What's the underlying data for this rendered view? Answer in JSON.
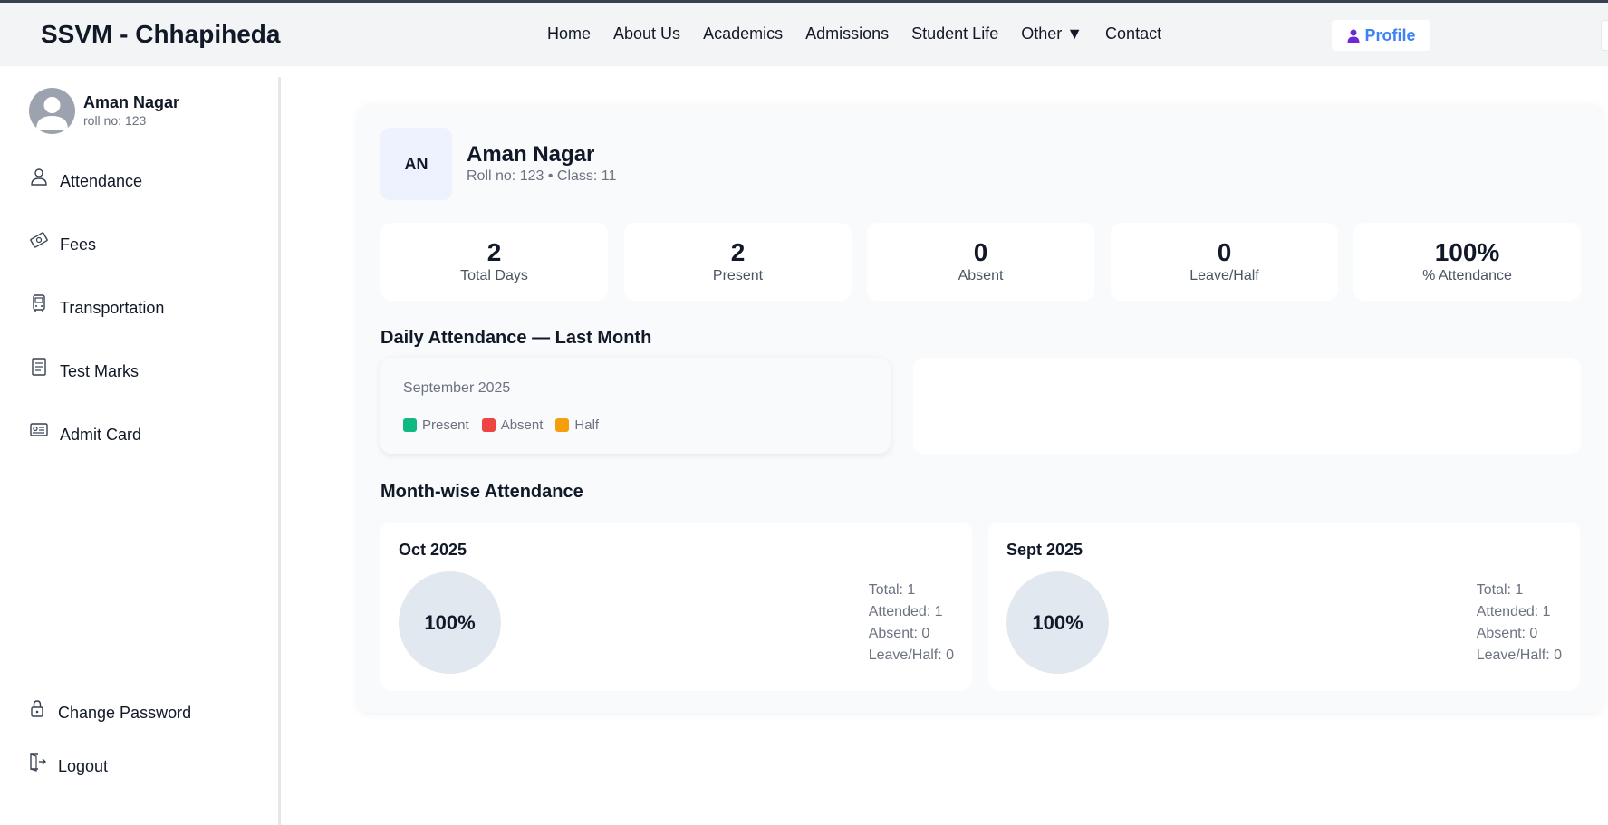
{
  "brand": {
    "title": "SSVM - Chhapiheda"
  },
  "nav": {
    "items": [
      "Home",
      "About Us",
      "Academics",
      "Admissions",
      "Student Life",
      "Other ▼",
      "Contact"
    ],
    "profile_label": "Profile"
  },
  "sidebar": {
    "user_name": "Aman Nagar",
    "user_roll": "roll no: 123",
    "items": [
      {
        "label": "Attendance",
        "icon": "user-icon"
      },
      {
        "label": "Fees",
        "icon": "money-icon"
      },
      {
        "label": "Transportation",
        "icon": "bus-icon"
      },
      {
        "label": "Test Marks",
        "icon": "document-icon"
      },
      {
        "label": "Admit Card",
        "icon": "id-card-icon"
      }
    ],
    "bottom_items": [
      {
        "label": "Change Password",
        "icon": "lock-icon"
      },
      {
        "label": "Logout",
        "icon": "logout-icon"
      }
    ]
  },
  "student": {
    "initials": "AN",
    "name": "Aman Nagar",
    "meta": "Roll no: 123 • Class: 11"
  },
  "stats": [
    {
      "value": "2",
      "label": "Total Days"
    },
    {
      "value": "2",
      "label": "Present"
    },
    {
      "value": "0",
      "label": "Absent"
    },
    {
      "value": "0",
      "label": "Leave/Half"
    },
    {
      "value": "100%",
      "label": "% Attendance"
    }
  ],
  "daily": {
    "title": "Daily Attendance — Last Month",
    "month": "September 2025",
    "legend": [
      {
        "label": "Present",
        "color": "#10b981"
      },
      {
        "label": "Absent",
        "color": "#ef4444"
      },
      {
        "label": "Half",
        "color": "#f59e0b"
      }
    ]
  },
  "monthwise": {
    "title": "Month-wise Attendance",
    "months": [
      {
        "name": "Oct 2025",
        "percent": "100%",
        "total": "Total: 1",
        "attended": "Attended: 1",
        "absent": "Absent: 0",
        "leave": "Leave/Half: 0"
      },
      {
        "name": "Sept 2025",
        "percent": "100%",
        "total": "Total: 1",
        "attended": "Attended: 1",
        "absent": "Absent: 0",
        "leave": "Leave/Half: 0"
      }
    ]
  },
  "colors": {
    "accent": "#3b82f6",
    "ring": "#e2e8f0"
  }
}
